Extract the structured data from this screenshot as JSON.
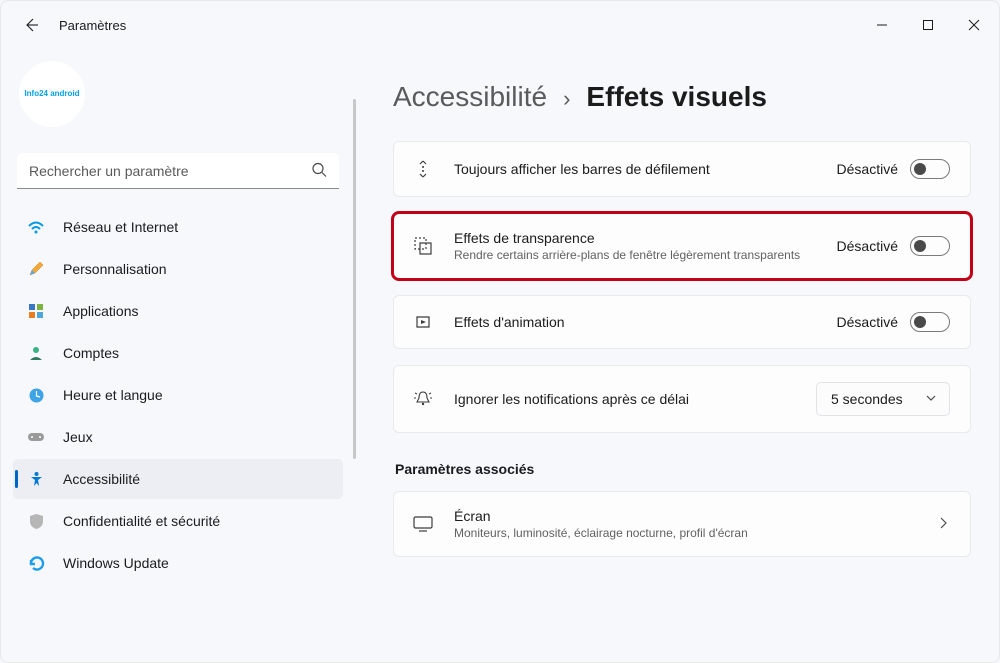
{
  "window": {
    "title": "Paramètres"
  },
  "search": {
    "placeholder": "Rechercher un paramètre"
  },
  "sidebar": {
    "items": [
      {
        "label": "Réseau et Internet"
      },
      {
        "label": "Personnalisation"
      },
      {
        "label": "Applications"
      },
      {
        "label": "Comptes"
      },
      {
        "label": "Heure et langue"
      },
      {
        "label": "Jeux"
      },
      {
        "label": "Accessibilité"
      },
      {
        "label": "Confidentialité et sécurité"
      },
      {
        "label": "Windows Update"
      }
    ]
  },
  "breadcrumb": {
    "parent": "Accessibilité",
    "separator": "›",
    "current": "Effets visuels"
  },
  "settings": {
    "scroll": {
      "title": "Toujours afficher les barres de défilement",
      "state": "Désactivé"
    },
    "transparency": {
      "title": "Effets de transparence",
      "subtitle": "Rendre certains arrière-plans de fenêtre légèrement transparents",
      "state": "Désactivé"
    },
    "animation": {
      "title": "Effets d'animation",
      "state": "Désactivé"
    },
    "notif": {
      "title": "Ignorer les notifications après ce délai",
      "value": "5 secondes"
    }
  },
  "related": {
    "heading": "Paramètres associés",
    "screen": {
      "title": "Écran",
      "subtitle": "Moniteurs, luminosité, éclairage nocturne, profil d'écran"
    }
  },
  "user": {
    "avatar_text": "Info24 android"
  }
}
